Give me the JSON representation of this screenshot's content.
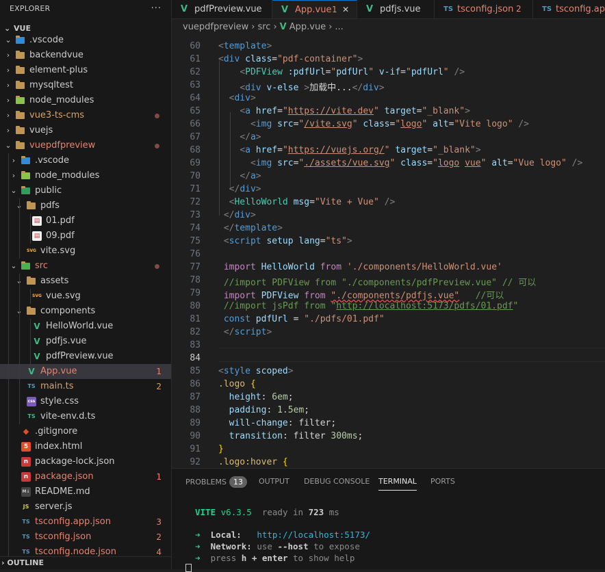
{
  "explorer": {
    "title": "EXPLORER",
    "more": "···",
    "section": "VUE",
    "outline": "OUTLINE"
  },
  "tree": [
    {
      "label": ".vscode",
      "depth": 1,
      "kind": "folder-vscode",
      "open": true,
      "color": "#cccccc"
    },
    {
      "label": "backendvue",
      "depth": 1,
      "kind": "folder",
      "open": false,
      "color": "#cccccc"
    },
    {
      "label": "element-plus",
      "depth": 1,
      "kind": "folder",
      "open": false,
      "color": "#cccccc"
    },
    {
      "label": "mysqltest",
      "depth": 1,
      "kind": "folder",
      "open": false,
      "color": "#cccccc"
    },
    {
      "label": "node_modules",
      "depth": 1,
      "kind": "folder-node",
      "open": false,
      "color": "#cccccc"
    },
    {
      "label": "vue3-ts-cms",
      "depth": 1,
      "kind": "folder",
      "open": false,
      "color": "#d7a26a",
      "dot": true
    },
    {
      "label": "vuejs",
      "depth": 1,
      "kind": "folder",
      "open": false,
      "color": "#cccccc"
    },
    {
      "label": "vuepdfpreview",
      "depth": 1,
      "kind": "folder",
      "open": true,
      "color": "#e8836f",
      "dot": true
    },
    {
      "label": ".vscode",
      "depth": 2,
      "kind": "folder-vscode",
      "open": false,
      "color": "#cccccc"
    },
    {
      "label": "node_modules",
      "depth": 2,
      "kind": "folder-node",
      "open": false,
      "color": "#cccccc"
    },
    {
      "label": "public",
      "depth": 2,
      "kind": "folder-public",
      "open": true,
      "color": "#cccccc"
    },
    {
      "label": "pdfs",
      "depth": 3,
      "kind": "folder",
      "open": true,
      "color": "#cccccc"
    },
    {
      "label": "01.pdf",
      "depth": 4,
      "kind": "pdf",
      "color": "#cccccc"
    },
    {
      "label": "09.pdf",
      "depth": 4,
      "kind": "pdf",
      "color": "#cccccc"
    },
    {
      "label": "vite.svg",
      "depth": 3,
      "kind": "svg",
      "color": "#cccccc"
    },
    {
      "label": "src",
      "depth": 2,
      "kind": "folder-src",
      "open": true,
      "color": "#e8836f",
      "dot": true
    },
    {
      "label": "assets",
      "depth": 3,
      "kind": "folder",
      "open": true,
      "color": "#cccccc"
    },
    {
      "label": "vue.svg",
      "depth": 4,
      "kind": "svg",
      "color": "#cccccc"
    },
    {
      "label": "components",
      "depth": 3,
      "kind": "folder",
      "open": true,
      "color": "#cccccc"
    },
    {
      "label": "HelloWorld.vue",
      "depth": 4,
      "kind": "vue",
      "color": "#cccccc"
    },
    {
      "label": "pdfjs.vue",
      "depth": 4,
      "kind": "vue",
      "color": "#cccccc"
    },
    {
      "label": "pdfPreview.vue",
      "depth": 4,
      "kind": "vue",
      "color": "#cccccc"
    },
    {
      "label": "App.vue",
      "depth": 3,
      "kind": "vue",
      "color": "#e8836f",
      "badge": "1",
      "selected": true
    },
    {
      "label": "main.ts",
      "depth": 3,
      "kind": "ts",
      "color": "#d7a26a",
      "badge": "2"
    },
    {
      "label": "style.css",
      "depth": 3,
      "kind": "css",
      "color": "#cccccc"
    },
    {
      "label": "vite-env.d.ts",
      "depth": 3,
      "kind": "tsd",
      "color": "#cccccc"
    },
    {
      "label": ".gitignore",
      "depth": 2,
      "kind": "git",
      "color": "#cccccc"
    },
    {
      "label": "index.html",
      "depth": 2,
      "kind": "html",
      "color": "#cccccc"
    },
    {
      "label": "package-lock.json",
      "depth": 2,
      "kind": "npm",
      "color": "#cccccc"
    },
    {
      "label": "package.json",
      "depth": 2,
      "kind": "npm",
      "color": "#e8836f",
      "badge": "1"
    },
    {
      "label": "README.md",
      "depth": 2,
      "kind": "md",
      "color": "#cccccc"
    },
    {
      "label": "server.js",
      "depth": 2,
      "kind": "js",
      "color": "#cccccc"
    },
    {
      "label": "tsconfig.app.json",
      "depth": 2,
      "kind": "tsconfig",
      "color": "#e8836f",
      "badge": "3"
    },
    {
      "label": "tsconfig.json",
      "depth": 2,
      "kind": "tsconfig",
      "color": "#e8836f",
      "badge": "2"
    },
    {
      "label": "tsconfig.node.json",
      "depth": 2,
      "kind": "tsconfig",
      "color": "#e8836f",
      "badge": "4"
    }
  ],
  "tabs": [
    {
      "label": "pdfPreview.vue",
      "icon": "vue",
      "color": "#cccccc"
    },
    {
      "label": "App.vue",
      "icon": "vue",
      "color": "#e8836f",
      "badge": "1",
      "close": "✕",
      "active": true
    },
    {
      "label": "pdfjs.vue",
      "icon": "vue",
      "color": "#cccccc"
    },
    {
      "label": "tsconfig.json",
      "icon": "ts",
      "color": "#e8836f",
      "badge": "2"
    },
    {
      "label": "tsconfig.app.",
      "icon": "ts",
      "color": "#e8836f"
    }
  ],
  "breadcrumb": [
    "vuepdfpreview",
    "src",
    "App.vue",
    "..."
  ],
  "editor": {
    "line_numbers": [
      "60",
      "61",
      "62",
      "63",
      "64",
      "65",
      "66",
      "67",
      "68",
      "69",
      "70",
      "71",
      "72",
      "73",
      "74",
      "75",
      "76",
      "77",
      "78",
      "79",
      "80",
      "81",
      "82",
      "83",
      "84",
      "85",
      "86",
      "87",
      "88",
      "89",
      "90",
      "91",
      "92"
    ],
    "current_line": "84"
  },
  "panel": {
    "tabs": [
      "PROBLEMS",
      "OUTPUT",
      "DEBUG CONSOLE",
      "TERMINAL",
      "PORTS"
    ],
    "problems_count": "13",
    "active_tab": "TERMINAL",
    "terminal": {
      "vite": "VITE",
      "version": "v6.3.5",
      "ready": "ready in",
      "ms_value": "723",
      "ms": "ms",
      "arrow": "➜",
      "local_label": "Local:",
      "local_url": "http://localhost:5173/",
      "network_label": "Network:",
      "network_text_1": "use",
      "network_flag": "--host",
      "network_text_2": "to expose",
      "help_1": "press",
      "help_key": "h + enter",
      "help_2": "to show help"
    }
  }
}
